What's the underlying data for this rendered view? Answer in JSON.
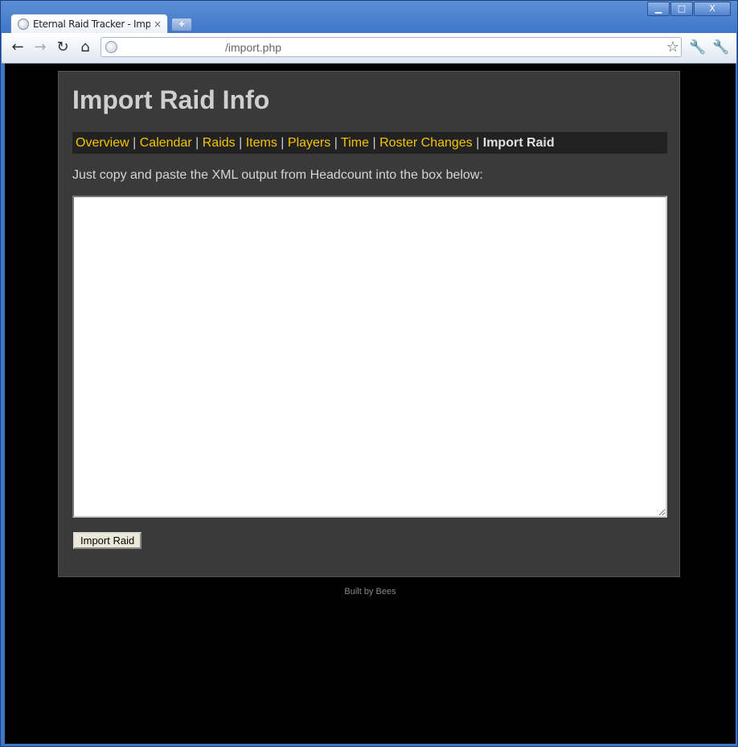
{
  "browser": {
    "tab_title": "Eternal Raid Tracker - Import Raid",
    "tab_close": "×",
    "new_tab": "+",
    "url": "/import.php",
    "window_buttons": {
      "minimize": "▁",
      "maximize": "□",
      "close": "X"
    }
  },
  "page": {
    "title": "Import Raid Info",
    "nav": [
      {
        "label": "Overview"
      },
      {
        "label": "Calendar"
      },
      {
        "label": "Raids"
      },
      {
        "label": "Items"
      },
      {
        "label": "Players"
      },
      {
        "label": "Time"
      },
      {
        "label": "Roster Changes"
      }
    ],
    "nav_current": "Import Raid",
    "nav_separator": "|",
    "instructions": "Just copy and paste the XML output from Headcount into the box below:",
    "textarea_value": "",
    "submit_label": "Import Raid",
    "footer": "Built by Bees"
  },
  "colors": {
    "link": "#f5c400",
    "panel": "#3a3a3a",
    "background": "#000000",
    "nav_bar": "#222222"
  },
  "icons": [
    "back-arrow-icon",
    "forward-arrow-icon",
    "reload-icon",
    "home-icon",
    "globe-icon",
    "star-icon",
    "page-menu-icon",
    "wrench-icon",
    "new-tab-icon",
    "close-icon"
  ]
}
